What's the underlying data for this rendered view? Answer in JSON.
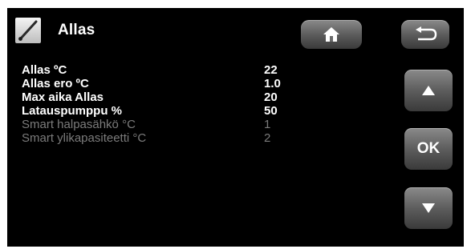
{
  "header": {
    "title": "Allas",
    "icon": "thermometer-probe-icon"
  },
  "navigation": {
    "home_icon": "home-icon",
    "back_icon": "back-arrow-icon",
    "up_icon": "up-arrow-icon",
    "ok_label": "OK",
    "down_icon": "down-arrow-icon"
  },
  "settings": [
    {
      "label": "Allas ºC",
      "value": "22",
      "enabled": true
    },
    {
      "label": "Allas ero ºC",
      "value": "1.0",
      "enabled": true
    },
    {
      "label": "Max aika Allas",
      "value": "20",
      "enabled": true
    },
    {
      "label": "Latauspumppu %",
      "value": "50",
      "enabled": true
    },
    {
      "label": "Smart halpasähkö °C",
      "value": "1",
      "enabled": false
    },
    {
      "label": "Smart ylikapasiteetti °C",
      "value": "2",
      "enabled": false
    }
  ],
  "colors": {
    "background": "#000000",
    "text": "#ffffff",
    "disabled_text": "#7b7b7b",
    "button": "#5d5d5d"
  }
}
